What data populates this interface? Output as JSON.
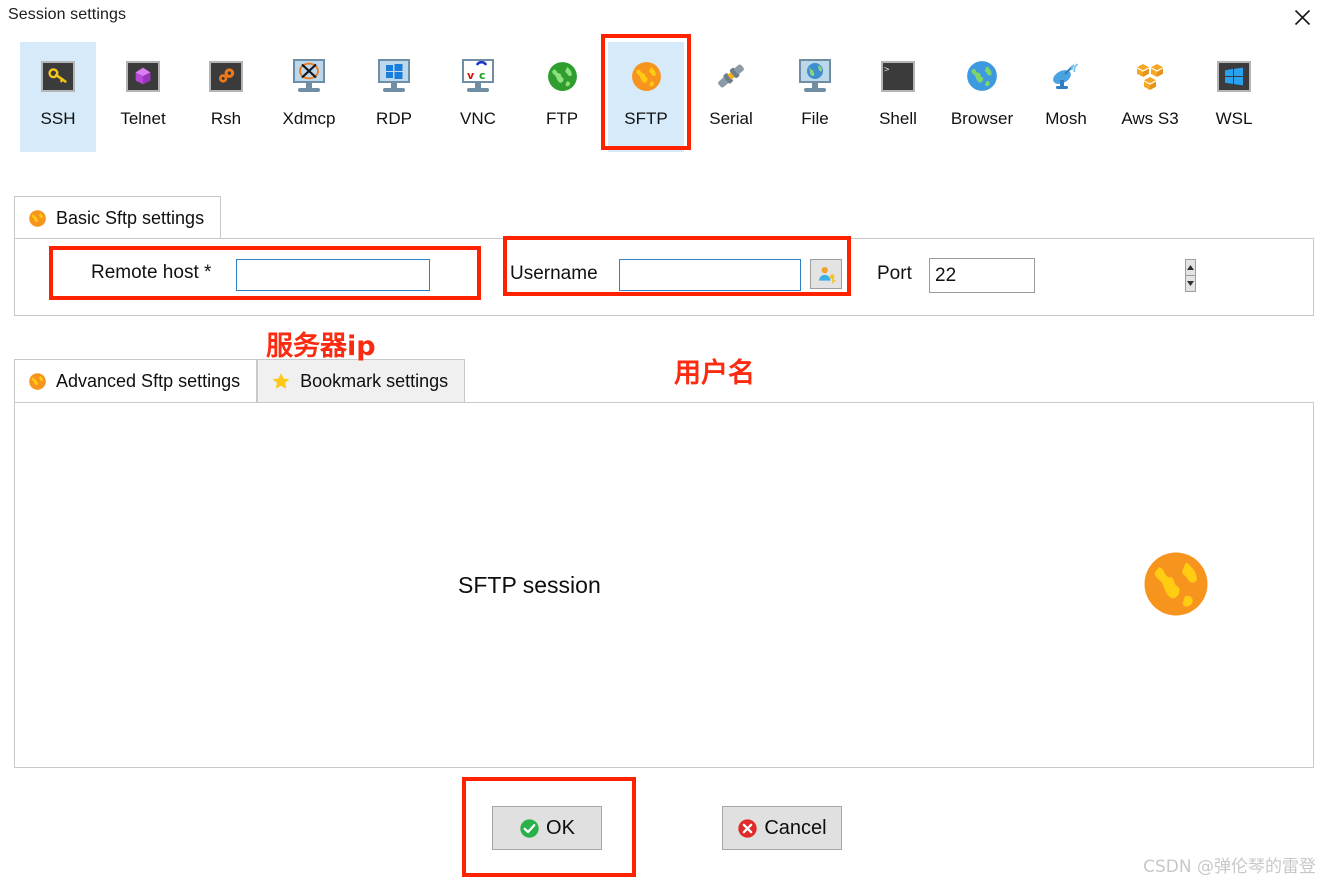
{
  "window": {
    "title": "Session settings",
    "close_label": "×"
  },
  "session_types": [
    {
      "label": "SSH",
      "icon": "ssh-key-icon",
      "selected": true
    },
    {
      "label": "Telnet",
      "icon": "telnet-cube-icon",
      "selected": false
    },
    {
      "label": "Rsh",
      "icon": "rsh-gears-icon",
      "selected": false
    },
    {
      "label": "Xdmcp",
      "icon": "xdmcp-monitor-icon",
      "selected": false
    },
    {
      "label": "RDP",
      "icon": "rdp-monitor-icon",
      "selected": false
    },
    {
      "label": "VNC",
      "icon": "vnc-monitor-icon",
      "selected": false
    },
    {
      "label": "FTP",
      "icon": "ftp-globe-icon",
      "selected": false
    },
    {
      "label": "SFTP",
      "icon": "sftp-globe-icon",
      "selected": false
    },
    {
      "label": "Serial",
      "icon": "serial-plug-icon",
      "selected": false
    },
    {
      "label": "File",
      "icon": "file-monitor-icon",
      "selected": false
    },
    {
      "label": "Shell",
      "icon": "shell-prompt-icon",
      "selected": false
    },
    {
      "label": "Browser",
      "icon": "browser-globe-icon",
      "selected": false
    },
    {
      "label": "Mosh",
      "icon": "mosh-satellite-icon",
      "selected": false
    },
    {
      "label": "Aws S3",
      "icon": "aws-s3-cubes-icon",
      "selected": false
    },
    {
      "label": "WSL",
      "icon": "wsl-windows-icon",
      "selected": false
    }
  ],
  "basic_tab": {
    "label": "Basic Sftp settings",
    "icon": "orange-globe-icon"
  },
  "basic_fields": {
    "remote_host_label": "Remote host *",
    "remote_host_value": "",
    "remote_host_placeholder": "",
    "username_label": "Username",
    "username_value": "",
    "username_placeholder": "",
    "username_picker_icon": "user-key-icon",
    "port_label": "Port",
    "port_value": "22",
    "spinner_up_icon": "triangle-up-icon",
    "spinner_down_icon": "triangle-down-icon"
  },
  "lower_tabs": [
    {
      "label": "Advanced Sftp settings",
      "icon": "orange-globe-icon",
      "active": true
    },
    {
      "label": "Bookmark settings",
      "icon": "yellow-star-icon",
      "active": false
    }
  ],
  "lower_panel": {
    "caption": "SFTP session",
    "illustration_icon": "orange-globe-large-icon"
  },
  "buttons": {
    "ok_label": "OK",
    "ok_icon": "green-check-icon",
    "cancel_label": "Cancel",
    "cancel_icon": "red-x-icon"
  },
  "annotations": {
    "server_ip_note": "服务器ip",
    "username_note": "用户名",
    "highlight_color": "#ff2200"
  },
  "watermark": "CSDN @弹伦琴的雷登"
}
